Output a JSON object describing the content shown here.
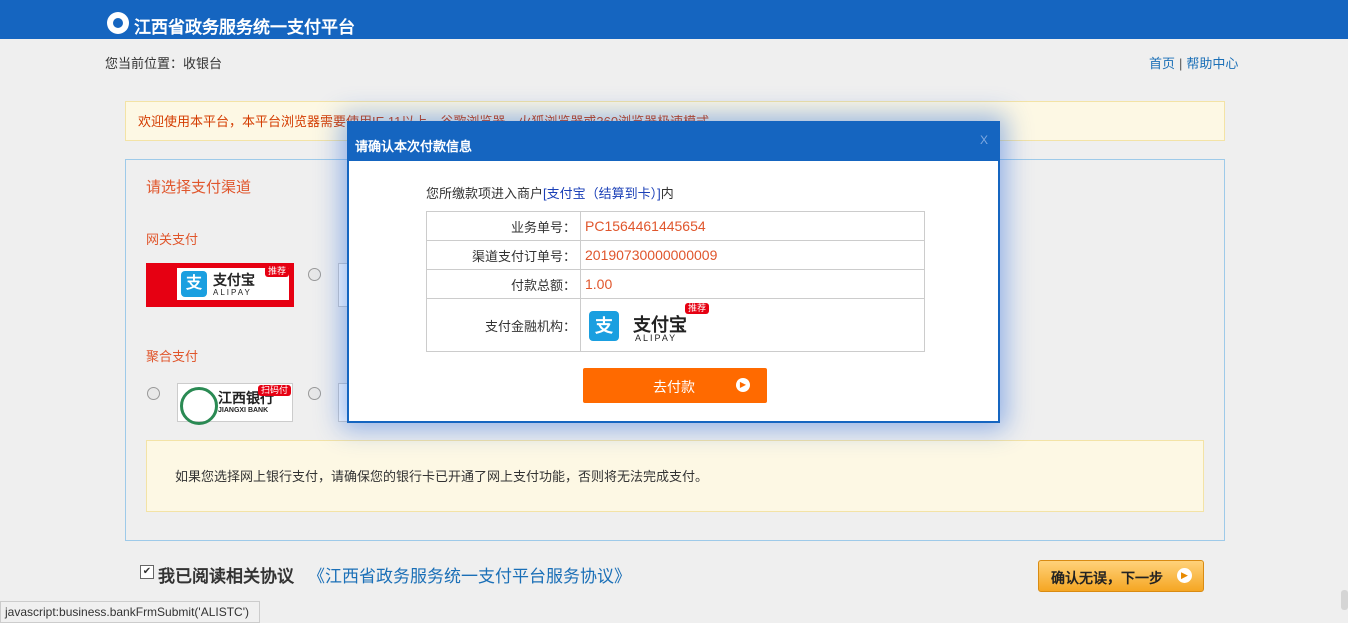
{
  "header": {
    "title": "江西省政务服务统一支付平台"
  },
  "breadcrumb": {
    "text": "您当前位置：收银台"
  },
  "toplinks": {
    "home": "首页",
    "sep": "|",
    "help": "帮助中心"
  },
  "notice": {
    "text": "欢迎使用本平台，本平台浏览器需要使用IE 11以上、谷歌浏览器、火狐浏览器或360浏览器极速模式"
  },
  "panel": {
    "title": "请选择支付渠道",
    "gateway_label": "网关支付",
    "aggregate_label": "聚合支付",
    "alipay": {
      "cn": "支付宝",
      "en": "ALIPAY",
      "badge": "推荐"
    },
    "jxbank": {
      "cn": "江西银行",
      "en": "JIANGXI BANK",
      "badge": "扫码付"
    },
    "warning": "如果您选择网上银行支付，请确保您的银行卡已开通了网上支付功能，否则将无法完成支付。"
  },
  "agreement": {
    "checked": true,
    "label": "我已阅读相关协议",
    "link": "《江西省政务服务统一支付平台服务协议》"
  },
  "next_button": {
    "label": "确认无误，下一步"
  },
  "statusbar": {
    "text": "javascript:business.bankFrmSubmit('ALISTC')"
  },
  "modal": {
    "title": "请确认本次付款信息",
    "close": "X",
    "intro_prefix": "您所缴款项进入商户",
    "merchant": "[支付宝（结算到卡）]",
    "intro_suffix": "内",
    "rows": [
      {
        "label": "业务单号：",
        "value": "PC1564461445654"
      },
      {
        "label": "渠道支付订单号：",
        "value": "20190730000000009"
      },
      {
        "label": "付款总额：",
        "value": "1.00"
      }
    ],
    "institution_label": "支付金融机构：",
    "pay_button": "去付款"
  }
}
